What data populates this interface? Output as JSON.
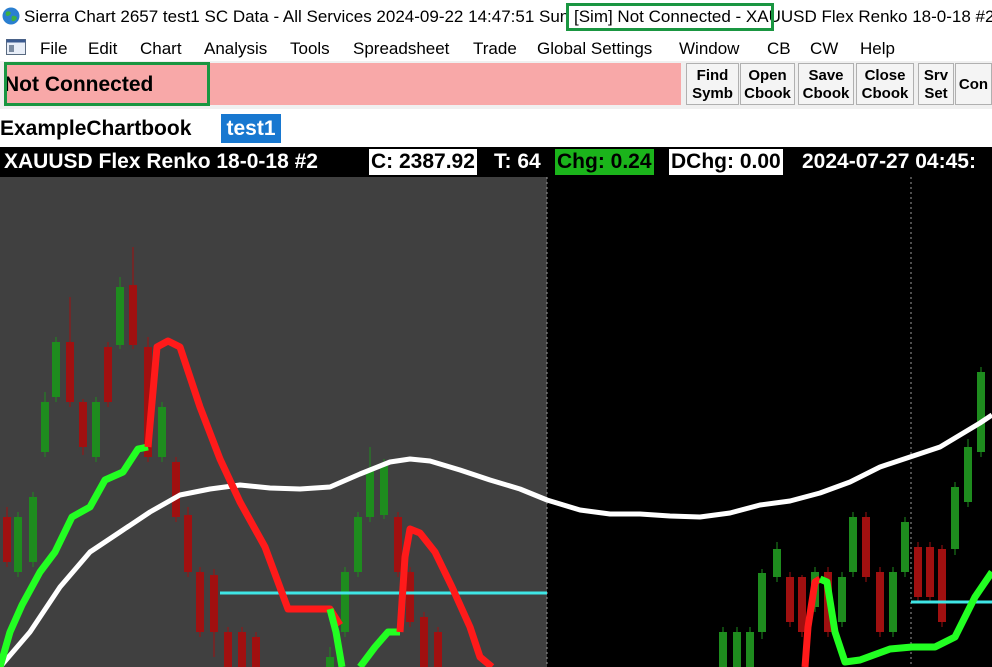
{
  "window": {
    "title": "Sierra Chart 2657 test1 SC Data - All Services 2024-09-22  14:47:51 Sun [Sim] Not Connected -  XAUUSD  Flex Renko 18-0-18 #2"
  },
  "menu": {
    "items": [
      "File",
      "Edit",
      "Chart",
      "Analysis",
      "Tools",
      "Spreadsheet",
      "Trade",
      "Global Settings",
      "Window",
      "CB",
      "CW",
      "Help"
    ]
  },
  "toolbar": {
    "status": "Not Connected",
    "buttons": [
      {
        "line1": "Find",
        "line2": "Symb"
      },
      {
        "line1": "Open",
        "line2": "Cbook"
      },
      {
        "line1": "Save",
        "line2": "Cbook"
      },
      {
        "line1": "Close",
        "line2": "Cbook"
      },
      {
        "line1": "Srv",
        "line2": "Set"
      },
      {
        "line1": "Con",
        "line2": ""
      }
    ]
  },
  "tabs": {
    "chartbook": "ExampleChartbook",
    "active": "test1"
  },
  "chart_header": {
    "symbol": "XAUUSD  Flex Renko 18-0-18 #2",
    "close": "C: 2387.92",
    "ticks": "T: 64",
    "change": "Chg: 0.24",
    "dchange": "DChg: 0.00",
    "datetime": "2024-07-27  04:45:"
  },
  "colors": {
    "up_bar": "#1e8c1e",
    "down_bar": "#a01010",
    "stop_up": "#22ff22",
    "stop_down": "#ff1a1a",
    "moving_average": "#ffffff",
    "level_line": "#3fe6e6",
    "session_bg": "#404040",
    "chart_bg": "#000000",
    "status_bg": "#f8a8a8",
    "highlight": "#1a9641",
    "tab_active": "#1878d0"
  },
  "chart_data": {
    "type": "candlestick",
    "symbol": "XAUUSD",
    "close": 2387.92,
    "change": 0.24
  }
}
